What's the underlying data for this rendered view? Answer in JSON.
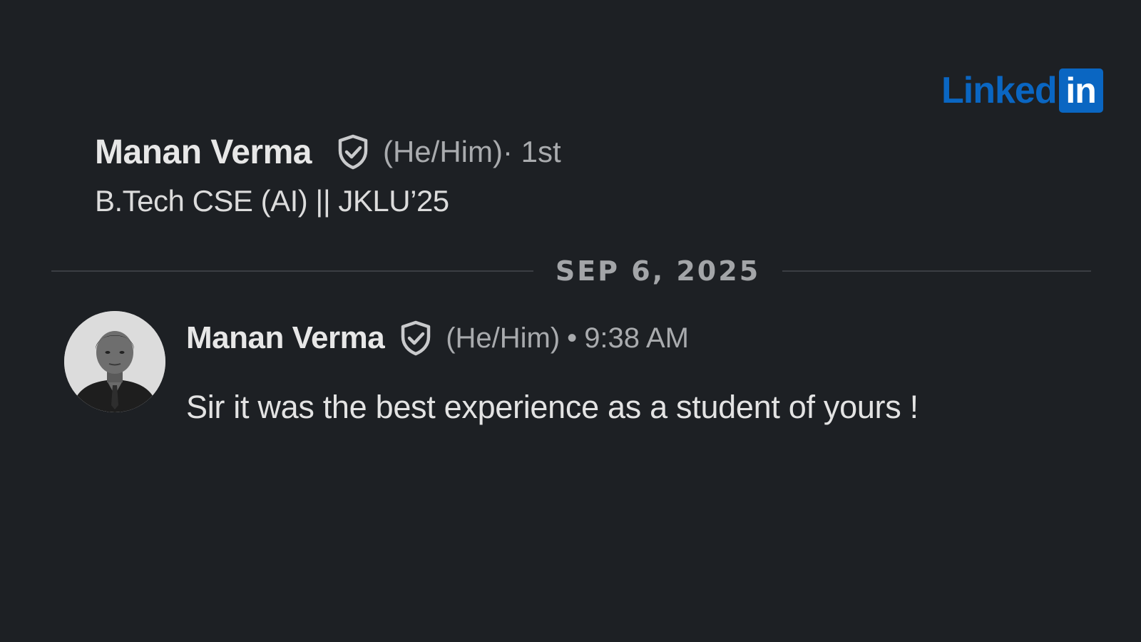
{
  "brand": {
    "logo_word": "Linked",
    "logo_box": "in",
    "color": "#0a66c2"
  },
  "profile": {
    "name": "Manan Verma",
    "badge_icon": "verified-shield-icon",
    "pronouns": "(He/Him)",
    "connection_degree": " · 1st",
    "headline": "B.Tech CSE (AI) || JKLU’25"
  },
  "conversation": {
    "date_divider": "SEP 6, 2025",
    "messages": [
      {
        "sender": "Manan Verma",
        "badge_icon": "verified-shield-icon",
        "pronouns": "(He/Him)",
        "separator": "•",
        "time": "9:38 AM",
        "text": "Sir it was the best experience as a student of yours !"
      }
    ]
  },
  "colors": {
    "background": "#1d2024",
    "primary_text": "#e7e7e7",
    "secondary_text": "#a9abae"
  }
}
